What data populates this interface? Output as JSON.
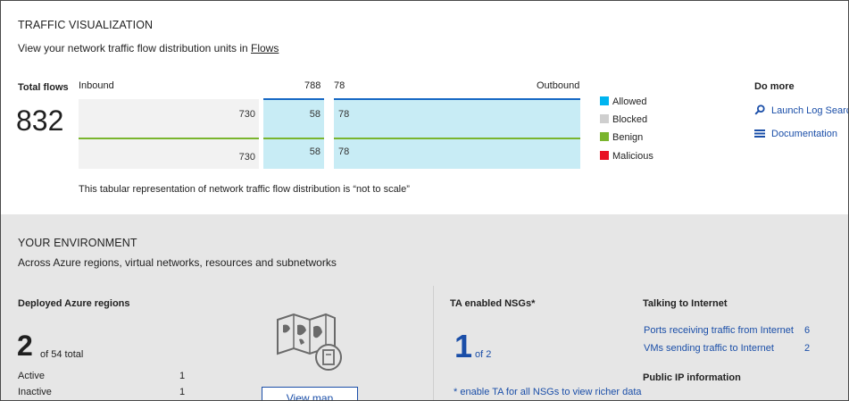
{
  "traffic": {
    "title": "TRAFFIC VISUALIZATION",
    "subtitle_text": "View your network traffic flow distribution units in",
    "flows_link": "Flows",
    "total_label": "Total flows",
    "total_value": "832",
    "inbound_label": "Inbound",
    "inbound_total": "788",
    "outbound_total": "78",
    "outbound_label": "Outbound",
    "cells": {
      "in_blocked_top": "730",
      "in_allowed_top": "58",
      "out_allowed_top": "78",
      "in_blocked_bottom": "730",
      "in_allowed_bottom": "58",
      "out_allowed_bottom": "78"
    },
    "note": "This tabular representation of network traffic flow distribution is “not to scale”",
    "legend": [
      {
        "label": "Allowed",
        "color": "#00b4f0"
      },
      {
        "label": "Blocked",
        "color": "#cfcfcf"
      },
      {
        "label": "Benign",
        "color": "#7ab52e"
      },
      {
        "label": "Malicious",
        "color": "#e81123"
      }
    ],
    "do_more": {
      "title": "Do more",
      "items": [
        {
          "label": "Launch Log Searc",
          "icon": "search-icon"
        },
        {
          "label": "Documentation",
          "icon": "list-icon"
        }
      ]
    }
  },
  "environment": {
    "title": "YOUR ENVIRONMENT",
    "subtitle": "Across Azure regions, virtual networks, resources and subnetworks",
    "regions": {
      "title": "Deployed Azure regions",
      "count": "2",
      "of_total": "of 54 total",
      "rows": [
        {
          "label": "Active",
          "value": "1"
        },
        {
          "label": "Inactive",
          "value": "1"
        }
      ],
      "map_icon": "world-map-icon",
      "view_map_button": "View map"
    },
    "nsgs": {
      "title": "TA enabled NSGs*",
      "count": "1",
      "of_total": "of 2",
      "note": "* enable TA for all NSGs to view richer data"
    },
    "internet": {
      "title": "Talking to Internet",
      "rows": [
        {
          "label": "Ports receiving traffic from Internet",
          "value": "6"
        },
        {
          "label": "VMs sending traffic to Internet",
          "value": "2"
        }
      ],
      "public_ip_title": "Public IP information"
    }
  }
}
